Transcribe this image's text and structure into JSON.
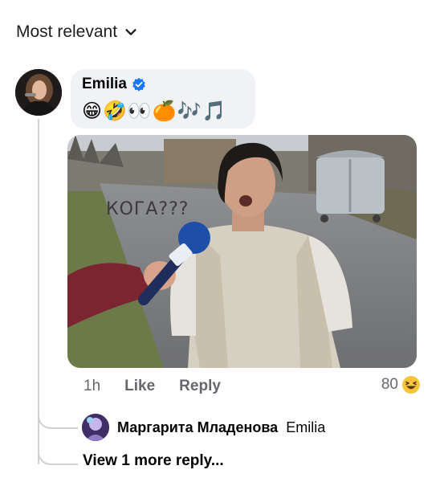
{
  "sort": {
    "label": "Most relevant",
    "icon": "chevron-down-icon"
  },
  "comment": {
    "author": "Emilia",
    "verified_icon": "verified-badge-icon",
    "verified_color": "#1877f2",
    "emoji_text": "😁🤣👀🍊🎶🎵",
    "attachment": {
      "caption": "КОГА???"
    },
    "time": "1h",
    "like_label": "Like",
    "reply_label": "Reply",
    "reaction_count": "80",
    "reaction_icon": "haha-reaction-icon"
  },
  "reply": {
    "author": "Маргарита Младенова",
    "snippet": "Emilia"
  },
  "view_more": "View 1 more reply..."
}
